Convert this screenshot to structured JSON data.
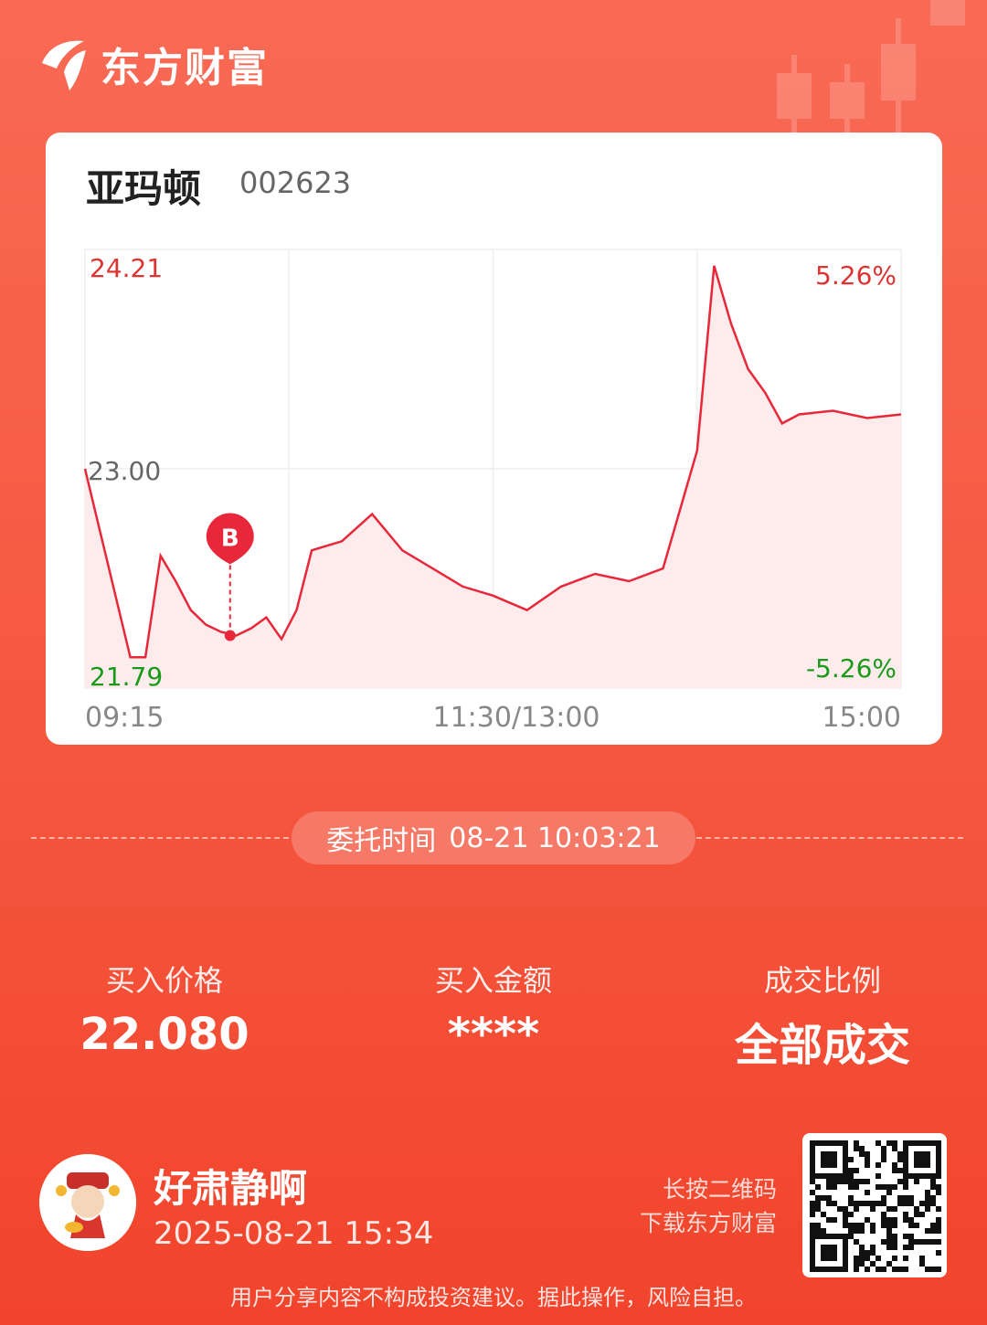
{
  "brand": {
    "name": "东方财富"
  },
  "stock": {
    "name": "亚玛顿",
    "code": "002623"
  },
  "chart_data": {
    "type": "line",
    "y_labels": {
      "max": "24.21",
      "mid": "23.00",
      "min": "21.79"
    },
    "pct_labels": {
      "max": "5.26%",
      "min": "-5.26%"
    },
    "x_labels": {
      "start": "09:15",
      "mid": "11:30/13:00",
      "end": "15:00"
    },
    "ylim": [
      21.79,
      24.21
    ],
    "marker": {
      "label": "B",
      "time": "10:03",
      "price": 22.08
    },
    "times": [
      "09:15",
      "09:30",
      "09:35",
      "09:40",
      "09:45",
      "09:50",
      "09:55",
      "10:00",
      "10:05",
      "10:10",
      "10:15",
      "10:20",
      "10:25",
      "10:30",
      "10:40",
      "10:50",
      "11:00",
      "11:10",
      "11:20",
      "11:30",
      "13:10",
      "13:20",
      "13:30",
      "13:40",
      "13:50",
      "14:00",
      "14:05",
      "14:10",
      "14:15",
      "14:20",
      "14:25",
      "14:30",
      "14:40",
      "14:50",
      "15:00"
    ],
    "series": [
      {
        "values": [
          23.0,
          21.96,
          21.96,
          22.52,
          22.38,
          22.22,
          22.14,
          22.1,
          22.08,
          22.12,
          22.18,
          22.06,
          22.22,
          22.55,
          22.6,
          22.75,
          22.55,
          22.45,
          22.35,
          22.3,
          22.22,
          22.35,
          22.42,
          22.38,
          22.45,
          23.1,
          24.12,
          23.8,
          23.55,
          23.42,
          23.25,
          23.3,
          23.32,
          23.28,
          23.3
        ]
      }
    ]
  },
  "order": {
    "label": "委托时间",
    "value": "08-21 10:03:21"
  },
  "metrics": [
    {
      "label": "买入价格",
      "value": "22.080"
    },
    {
      "label": "买入金额",
      "value": "****"
    },
    {
      "label": "成交比例",
      "value": "全部成交"
    }
  ],
  "user": {
    "name": "好肃静啊",
    "time": "2025-08-21 15:34"
  },
  "qr": {
    "hint_line1": "长按二维码",
    "hint_line2": "下载东方财富"
  },
  "disclaimer": "用户分享内容不构成投资建议。据此操作，风险自担。",
  "colors": {
    "up": "#e8283a",
    "down": "#1aa01a",
    "fill": "#fdeceb"
  }
}
